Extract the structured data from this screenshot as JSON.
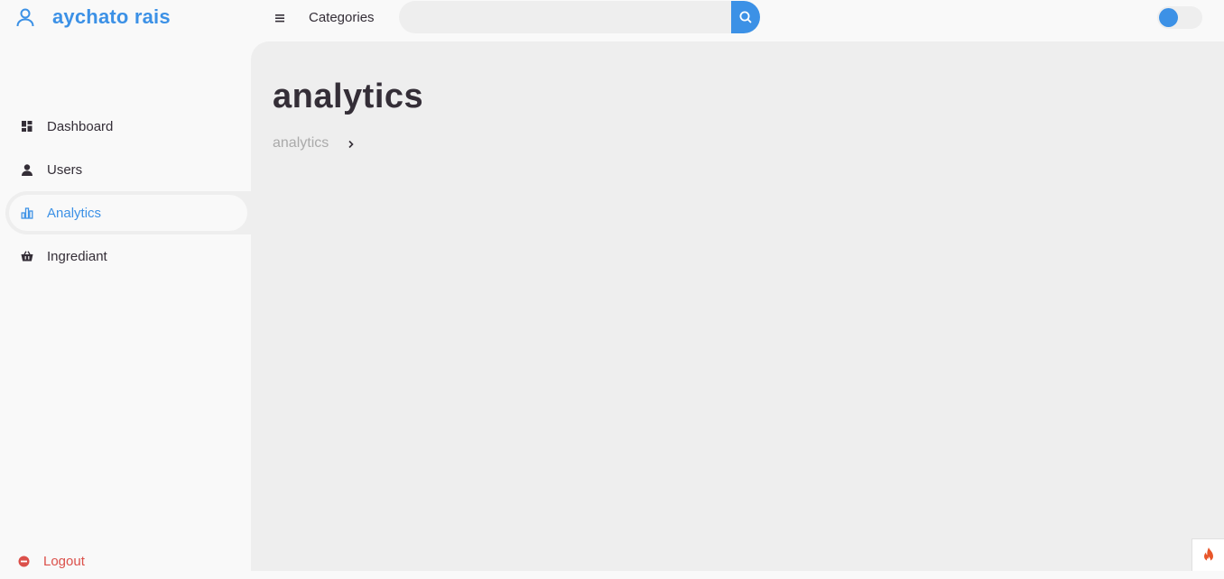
{
  "brand": {
    "name": "aychato rais",
    "icon": "user-icon"
  },
  "topbar": {
    "menu_icon": "menu-icon",
    "categories_label": "Categories",
    "search": {
      "value": "",
      "placeholder": "",
      "button_icon": "search-icon"
    },
    "theme_toggle": {
      "on": false
    }
  },
  "sidebar": {
    "items": [
      {
        "label": "Dashboard",
        "icon": "dashboard-icon",
        "active": false
      },
      {
        "label": "Users",
        "icon": "user-icon",
        "active": false
      },
      {
        "label": "Analytics",
        "icon": "bar-chart-icon",
        "active": true
      },
      {
        "label": "Ingrediant",
        "icon": "basket-icon",
        "active": false
      }
    ],
    "logout": {
      "label": "Logout",
      "icon": "logout-icon"
    }
  },
  "main": {
    "title": "analytics",
    "breadcrumb": [
      "analytics"
    ]
  },
  "colors": {
    "accent": "#3c91e6",
    "text": "#342e37",
    "muted": "#aaaaaa",
    "danger": "#db504a",
    "panel": "#eeeeee",
    "light": "#f9f9f9",
    "flame": "#e8562a"
  }
}
